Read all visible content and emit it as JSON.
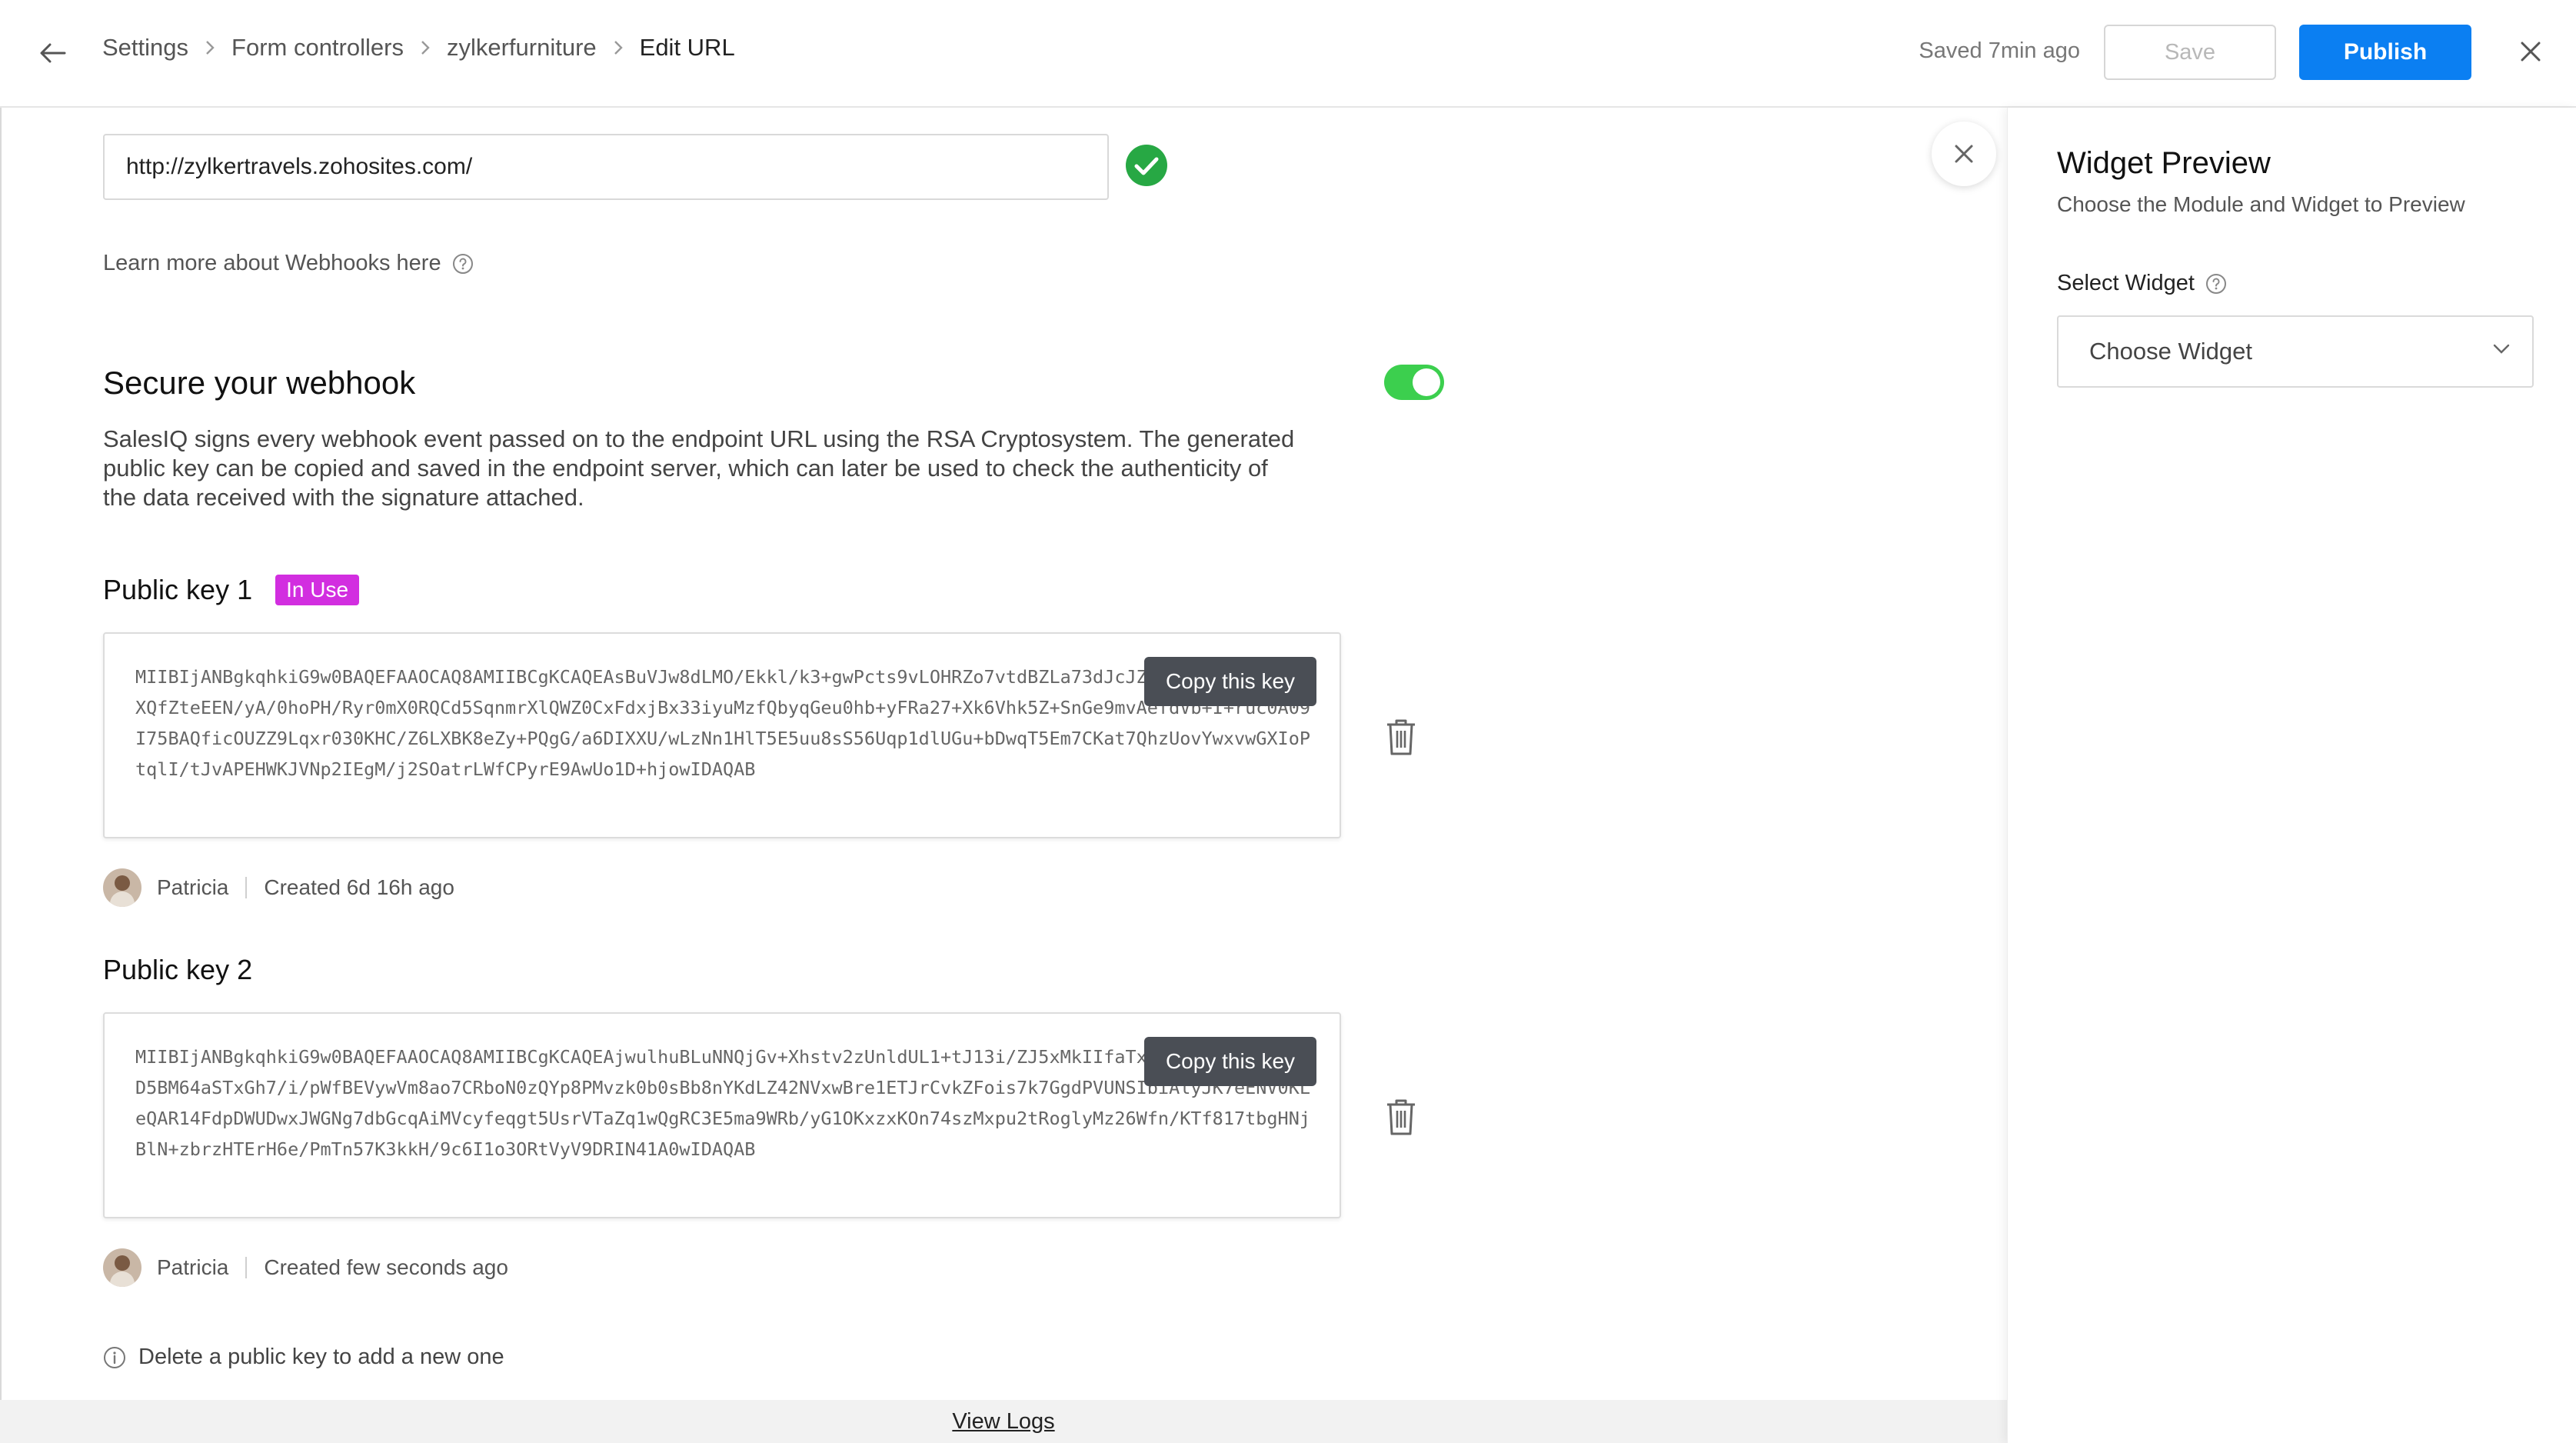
{
  "header": {
    "breadcrumb": [
      "Settings",
      "Form controllers",
      "zylkerfurniture",
      "Edit URL"
    ],
    "saved_text": "Saved 7min ago",
    "save_label": "Save",
    "publish_label": "Publish"
  },
  "webhook": {
    "url_value": "http://zylkertravels.zohosites.com/",
    "learn_more": "Learn more about Webhooks here"
  },
  "secure": {
    "title": "Secure your webhook",
    "enabled": true,
    "description": "SalesIQ signs every webhook event passed on to the endpoint URL using the RSA Cryptosystem. The generated public key can be copied and saved in the endpoint server, which can later be used to check the authenticity of the data received with the signature attached."
  },
  "keys": [
    {
      "title": "Public key 1",
      "badge": "In Use",
      "key_text": "MIIBIjANBgkqhkiG9w0BAQEFAAOCAQ8AMIIBCgKCAQEAsBuVJw8dLMO/Ekkl/k3+gwPcts9vLOHRZo7vtdBZLa73dJcJZQzD9S120x4KNueLXQfZteEEN/yA/0hoPH/Ryr0mX0RQCd5SqnmrXlQWZ0CxFdxjBx33iyuMzfQbyqGeu0hb+yFRa27+Xk6Vhk5Z+SnGe9mvAefdVb+I+ruc0A09I75BAQficOUZZ9Lqxr030KHC/Z6LXBK8eZy+PQgG/a6DIXXU/wLzNn1HlT5E5uu8sS56Uqp1dlUGu+bDwqT5Em7CKat7QhzUovYwxvwGXIoPtqlI/tJvAPEHWKJVNp2IEgM/j2SOatrLWfCPyrE9AwUo1D+hjowIDAQAB",
      "copy_label": "Copy this key",
      "author": "Patricia",
      "created": "Created 6d 16h ago"
    },
    {
      "title": "Public key 2",
      "badge": "",
      "key_text": "MIIBIjANBgkqhkiG9w0BAQEFAAOCAQ8AMIIBCgKCAQEAjwulhuBLuNNQjGv+Xhstv2zUnldUL1+tJ13i/ZJ5xMkIIfaTx0XM+t7vf6J9o2YuD5BM64aSTxGh7/i/pWfBEVywVm8ao7CRboN0zQYp8PMvzk0b0sBb8nYKdLZ42NVxwBre1ETJrCvkZFois7k7GgdPVUNSIbiAlyJK7eENV0KLeQAR14FdpDWUDwxJWGNg7dbGcqAiMVcyfeqgt5UsrVTaZq1wQgRC3E5ma9WRb/yG1OKxzxKOn74szMxpu2tRoglyMz26Wfn/KTf817tbgHNjBlN+zbrzHTErH6e/PmTn57K3kkH/9c6I1o3ORtVyV9DRIN41A0wIDAQAB",
      "copy_label": "Copy this key",
      "author": "Patricia",
      "created": "Created few seconds ago"
    }
  ],
  "info_note": "Delete a public key to add a new one",
  "view_logs": "View Logs",
  "panel": {
    "title": "Widget Preview",
    "subtitle": "Choose the Module and Widget to Preview",
    "select_label": "Select Widget",
    "select_value": "Choose Widget"
  },
  "colors": {
    "accent": "#0b7ff2",
    "toggle_on": "#3ccf4e",
    "success": "#27a844",
    "badge": "#d22ee0"
  },
  "icons": [
    "arrow-left-icon",
    "chevron-right-icon",
    "close-icon",
    "check-circle-icon",
    "question-circle-icon",
    "trash-icon",
    "info-circle-icon",
    "chevron-down-icon"
  ]
}
